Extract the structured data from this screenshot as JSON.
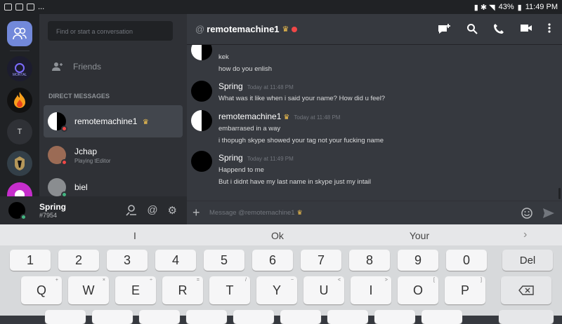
{
  "status_bar": {
    "battery": "43%",
    "time": "11:49 PM",
    "more": "..."
  },
  "sidebar": {
    "search_placeholder": "Find or start a conversation",
    "friends_label": "Friends",
    "dm_header": "DIRECT MESSAGES",
    "dms": [
      {
        "name": "remotemachine1",
        "sub": "",
        "status_color": "#f04747"
      },
      {
        "name": "Jchap",
        "sub": "Playing tEditor",
        "status_color": "#f04747"
      },
      {
        "name": "biel",
        "sub": "",
        "status_color": "#43b581"
      }
    ]
  },
  "guilds": [
    {
      "label": ""
    },
    {
      "label": "MORTAL"
    },
    {
      "label": ""
    },
    {
      "label": "T"
    },
    {
      "label": ""
    }
  ],
  "user_panel": {
    "username": "Spring",
    "tag": "#7954"
  },
  "chat_header": {
    "at": "@",
    "title": "remotemachine1"
  },
  "messages": [
    {
      "author": "",
      "time": "",
      "lines": [
        "kek",
        "how do you enlish"
      ]
    },
    {
      "author": "Spring",
      "time": "Today at 11:48 PM",
      "lines": [
        "What was it like when i said your name? How did u feel?"
      ]
    },
    {
      "author": "remotemachine1",
      "time": "Today at 11:48 PM",
      "lines": [
        "embarrased in a way",
        "i thopugh skype showed your tag not your fucking name"
      ]
    },
    {
      "author": "Spring",
      "time": "Today at 11:49 PM",
      "lines": [
        "Happend to me",
        "But i didnt have my last name in skype just my intail"
      ]
    }
  ],
  "composer": {
    "placeholder": "Message @remotemachine1"
  },
  "keyboard": {
    "suggestions": [
      "I",
      "Ok",
      "Your"
    ],
    "suggestion_arrow": "›",
    "number_row": [
      "1",
      "2",
      "3",
      "4",
      "5",
      "6",
      "7",
      "8",
      "9",
      "0"
    ],
    "del_label": "Del",
    "letter_row": [
      "Q",
      "W",
      "E",
      "R",
      "T",
      "Y",
      "U",
      "I",
      "O",
      "P"
    ],
    "letter_hints": [
      "+",
      "×",
      "÷",
      "=",
      "/",
      "−",
      "<",
      ">",
      "[",
      "]"
    ]
  }
}
